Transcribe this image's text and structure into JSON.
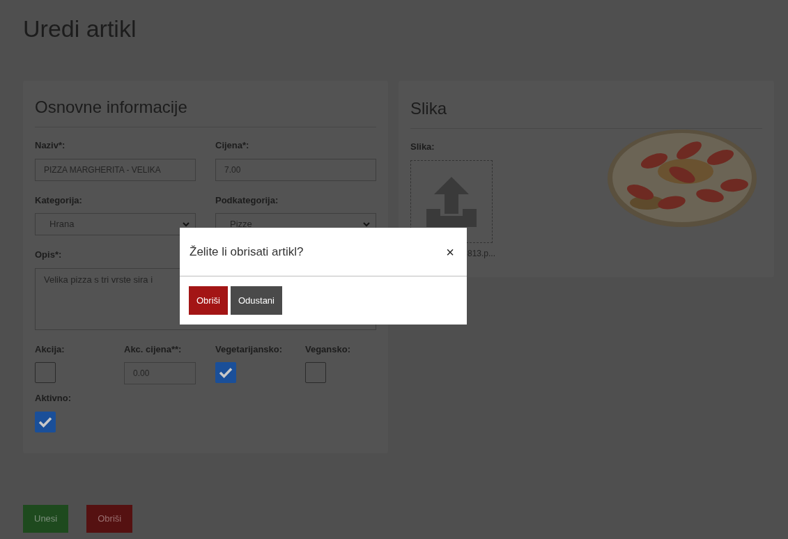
{
  "page_title": "Uredi artikl",
  "basic_info": {
    "title": "Osnovne informacije",
    "name": {
      "label": "Naziv*:",
      "value": "PIZZA MARGHERITA - VELIKA"
    },
    "price": {
      "label": "Cijena*:",
      "value": "7.00"
    },
    "category": {
      "label": "Kategorija:",
      "value": "Hrana"
    },
    "subcategory": {
      "label": "Podkategorija:",
      "value": "Pizze"
    },
    "description": {
      "label": "Opis*:",
      "value": "Velika pizza s tri vrste sira i"
    },
    "options": [
      {
        "kind": "checkbox",
        "label": "Akcija:",
        "checked": false
      },
      {
        "kind": "input",
        "label": "Akc. cijena**:",
        "value": "0.00"
      },
      {
        "kind": "checkbox",
        "label": "Vegetarijansko:",
        "checked": true
      },
      {
        "kind": "checkbox",
        "label": "Vegansko:",
        "checked": false
      },
      {
        "kind": "checkbox",
        "label": "Aktivno:",
        "checked": true
      }
    ]
  },
  "image_panel": {
    "title": "Slika",
    "label": "Slika:",
    "filename": "813.p..."
  },
  "actions": [
    {
      "label": "Unesi",
      "kind": "save"
    },
    {
      "label": "Obriši",
      "kind": "delete"
    }
  ],
  "dialog": {
    "title": "Želite li obrisati artikl?",
    "close": "×",
    "buttons": [
      {
        "label": "Obriši",
        "kind": "delete"
      },
      {
        "label": "Odustani",
        "kind": "cancel"
      }
    ]
  }
}
